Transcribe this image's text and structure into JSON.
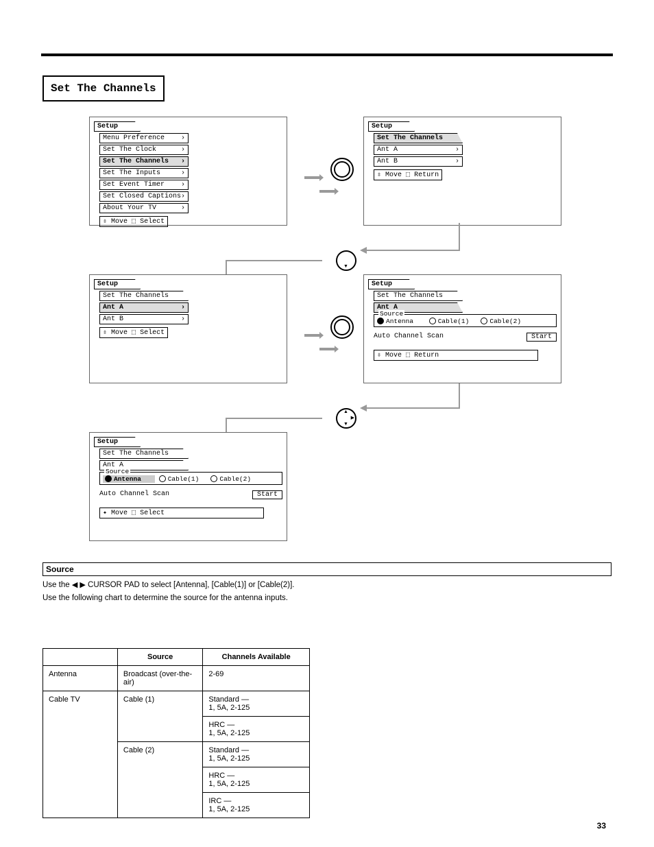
{
  "section_title": "Set The Channels",
  "screens": {
    "s1": {
      "tab": "Setup",
      "items": [
        {
          "label": "Menu Preference",
          "hl": false
        },
        {
          "label": "Set The Clock",
          "hl": false
        },
        {
          "label": "Set The Channels",
          "hl": true
        },
        {
          "label": "Set The Inputs",
          "hl": false
        },
        {
          "label": "Set Event Timer",
          "hl": false
        },
        {
          "label": "Set Closed Captions",
          "hl": false
        },
        {
          "label": "About Your TV",
          "hl": false
        }
      ],
      "hint_left": "Move",
      "hint_right": "Select"
    },
    "s2": {
      "tab": "Setup",
      "sub": "Set The Channels",
      "items": [
        {
          "label": "Ant A",
          "hl": false
        },
        {
          "label": "Ant B",
          "hl": false
        }
      ],
      "hint_left": "Move",
      "hint_right": "Return"
    },
    "s3": {
      "tab": "Setup",
      "sub": "Set The Channels",
      "items": [
        {
          "label": "Ant A",
          "hl": true
        },
        {
          "label": "Ant B",
          "hl": false
        }
      ],
      "hint_left": "Move",
      "hint_right": "Select"
    },
    "s4": {
      "tab": "Setup",
      "sub": "Set The Channels",
      "sub2": "Ant A",
      "source_legend": "Source",
      "radios": [
        {
          "label": "Antenna",
          "sel": true,
          "hl": false
        },
        {
          "label": "Cable(1)",
          "sel": false,
          "hl": false
        },
        {
          "label": "Cable(2)",
          "sel": false,
          "hl": false
        }
      ],
      "acs_label": "Auto Channel Scan",
      "start": "Start",
      "hint_left": "Move",
      "hint_right": "Return"
    },
    "s5": {
      "tab": "Setup",
      "sub": "Set The Channels",
      "sub2": "Ant A",
      "source_legend": "Source",
      "radios": [
        {
          "label": "Antenna",
          "sel": true,
          "hl": true
        },
        {
          "label": "Cable(1)",
          "sel": false,
          "hl": false
        },
        {
          "label": "Cable(2)",
          "sel": false,
          "hl": false
        }
      ],
      "acs_label": "Auto Channel Scan",
      "start": "Start",
      "hint_left": "Move",
      "hint_right": "Select"
    }
  },
  "source_heading": "Source",
  "source_p1_pre": "Use the ",
  "source_p1_mid": " CURSOR PAD to select [Antenna], [Cable(1)] or [Cable(2)].",
  "source_p2": "Use the following chart to determine the source for the antenna inputs.",
  "table": {
    "head": [
      "",
      "Source",
      "Channels Available"
    ],
    "rows": [
      [
        "Antenna",
        "Broadcast (over-the-air)",
        "2-69"
      ],
      [
        "Cable TV",
        "Cable (1)",
        "Standard —\n1, 5A, 2-125"
      ],
      [
        "",
        "",
        "HRC —\n1, 5A, 2-125"
      ],
      [
        "",
        "Cable (2)",
        "Standard —\n1, 5A, 2-125"
      ],
      [
        "",
        "",
        "HRC —\n1, 5A, 2-125"
      ],
      [
        "",
        "",
        "IRC —\n1, 5A, 2-125"
      ]
    ]
  },
  "pagenum": "33"
}
